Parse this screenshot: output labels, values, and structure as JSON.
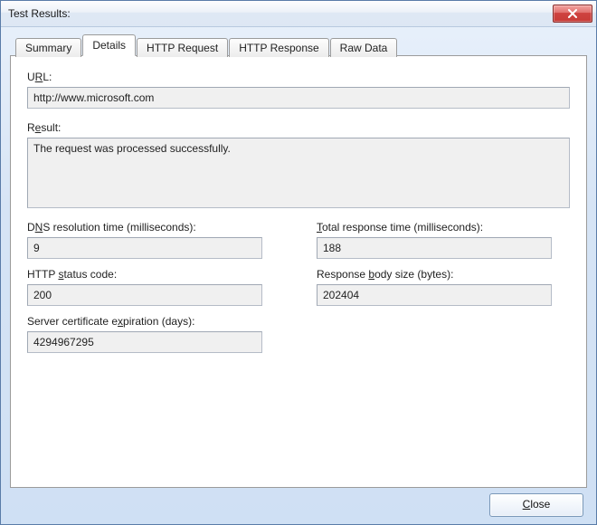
{
  "window": {
    "title": "Test Results:"
  },
  "tabs": {
    "summary": "Summary",
    "details": "Details",
    "http_request": "HTTP Request",
    "http_response": "HTTP Response",
    "raw_data": "Raw Data"
  },
  "details": {
    "url_label_pre": "U",
    "url_label_u": "R",
    "url_label_post": "L:",
    "url_value": "http://www.microsoft.com",
    "result_label_pre": "R",
    "result_label_u": "e",
    "result_label_post": "sult:",
    "result_value": "The request was processed successfully.",
    "dns_label_pre": "D",
    "dns_label_u": "N",
    "dns_label_post": "S resolution time (milliseconds):",
    "dns_value": "9",
    "total_label_u": "T",
    "total_label_post": "otal response time (milliseconds):",
    "total_value": "188",
    "http_status_label_pre": "HTTP ",
    "http_status_label_u": "s",
    "http_status_label_post": "tatus code:",
    "http_status_value": "200",
    "body_label_pre": "Response ",
    "body_label_u": "b",
    "body_label_post": "ody size (bytes):",
    "body_value": "202404",
    "cert_label_pre": "Server certificate e",
    "cert_label_u": "x",
    "cert_label_post": "piration (days):",
    "cert_value": "4294967295"
  },
  "buttons": {
    "close_u": "C",
    "close_post": "lose"
  }
}
